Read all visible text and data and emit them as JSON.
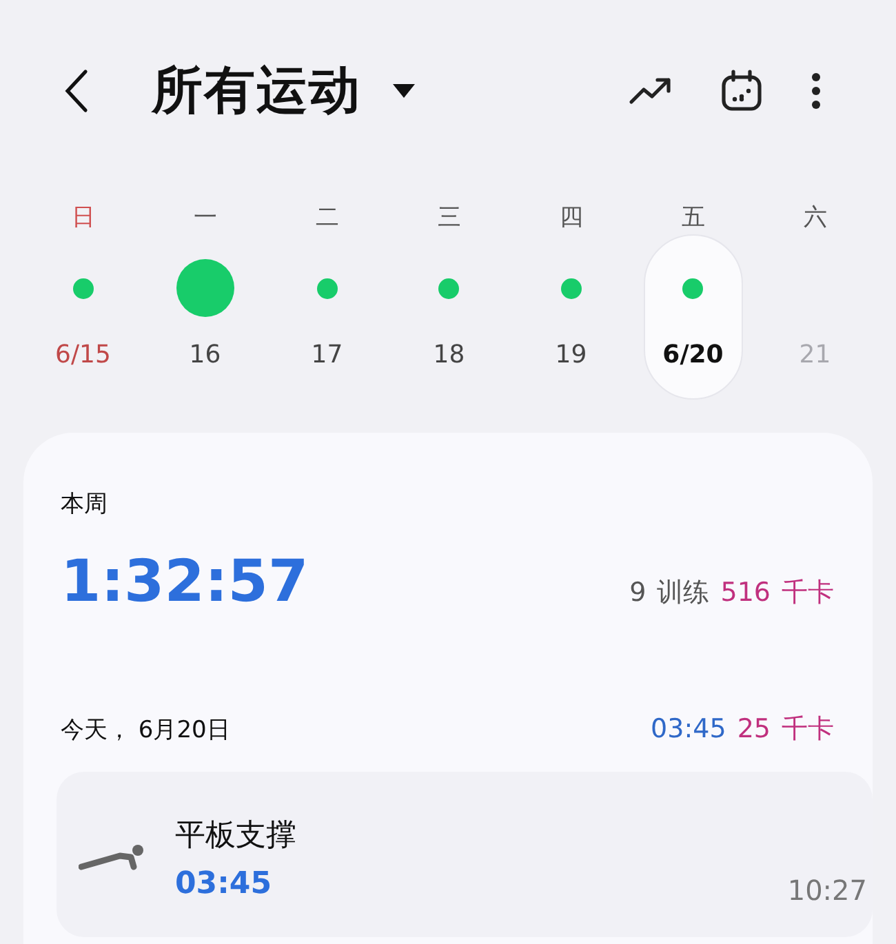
{
  "header": {
    "title": "所有运动"
  },
  "week": [
    {
      "weekday": "日",
      "date": "6/15",
      "kind": "sunday",
      "activity": true,
      "large_dot": false,
      "selected": false,
      "disabled": false
    },
    {
      "weekday": "一",
      "date": "16",
      "kind": "weekday",
      "activity": true,
      "large_dot": true,
      "selected": false,
      "disabled": false
    },
    {
      "weekday": "二",
      "date": "17",
      "kind": "weekday",
      "activity": true,
      "large_dot": false,
      "selected": false,
      "disabled": false
    },
    {
      "weekday": "三",
      "date": "18",
      "kind": "weekday",
      "activity": true,
      "large_dot": false,
      "selected": false,
      "disabled": false
    },
    {
      "weekday": "四",
      "date": "19",
      "kind": "weekday",
      "activity": true,
      "large_dot": false,
      "selected": false,
      "disabled": false
    },
    {
      "weekday": "五",
      "date": "6/20",
      "kind": "weekday",
      "activity": true,
      "large_dot": false,
      "selected": true,
      "disabled": false
    },
    {
      "weekday": "六",
      "date": "21",
      "kind": "weekday",
      "activity": false,
      "selected": false,
      "disabled": true
    }
  ],
  "summary": {
    "label": "本周",
    "duration": "1:32:57",
    "workouts": "9",
    "workouts_label": "训练",
    "calories": "516",
    "calories_unit": "千卡"
  },
  "day": {
    "label": "今天， 6月20日",
    "duration": "03:45",
    "calories": "25",
    "calories_unit": "千卡"
  },
  "activities": [
    {
      "name": "平板支撑",
      "duration": "03:45",
      "time": "10:27"
    }
  ]
}
